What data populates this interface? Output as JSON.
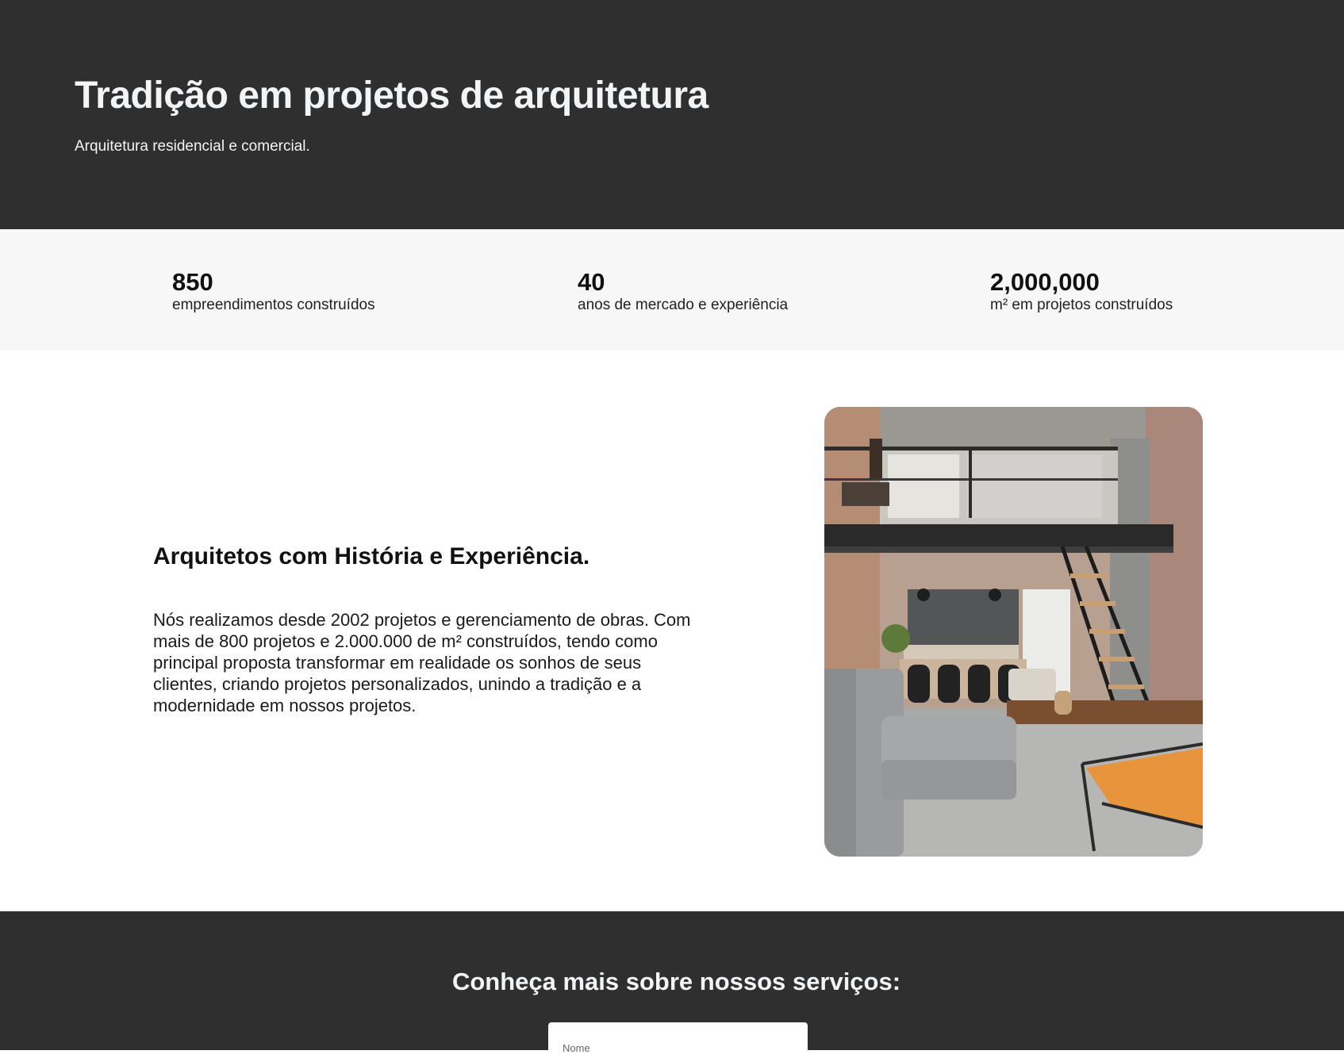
{
  "hero": {
    "title": "Tradição em projetos de arquitetura",
    "subtitle": "Arquitetura residencial e comercial."
  },
  "stats": [
    {
      "value": "850",
      "label": "empreendimentos construídos"
    },
    {
      "value": "40",
      "label": "anos de mercado e experiência"
    },
    {
      "value": "2,000,000",
      "label": "m² em projetos construídos"
    }
  ],
  "about": {
    "heading": "Arquitetos com História e Experiência.",
    "paragraph": "Nós realizamos desde 2002 projetos e gerenciamento de obras. Com mais de 800 projetos e 2.000.000 de m² construídos, tendo como principal proposta transformar em realidade os sonhos de seus clientes, criando projetos personalizados, unindo a tradição e a modernidade em nossos projetos."
  },
  "contact": {
    "heading": "Conheça mais sobre nossos serviços:",
    "name_placeholder": "Nome"
  },
  "colors": {
    "dark_bg": "#2f2f2f",
    "stats_bg": "#f7f7f7",
    "accent_chair": "#e8943c"
  }
}
